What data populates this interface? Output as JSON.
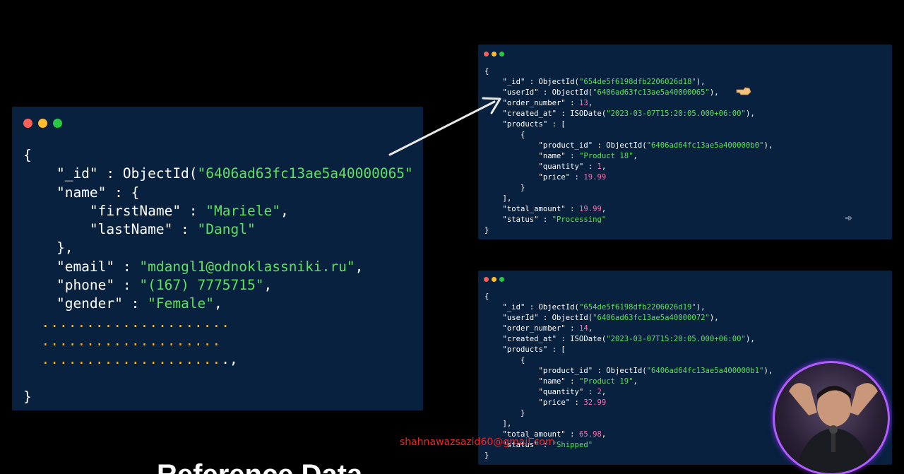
{
  "main_document": {
    "lines": [
      [
        {
          "t": "{",
          "c": "p"
        }
      ],
      [
        {
          "t": "    \"_id\" : ObjectId(",
          "c": "p"
        },
        {
          "t": "\"6406ad63fc13ae5a40000065\"",
          "c": "s"
        }
      ],
      [
        {
          "t": "    \"name\" : {",
          "c": "p"
        }
      ],
      [
        {
          "t": "        \"firstName\" : ",
          "c": "p"
        },
        {
          "t": "\"Mariele\"",
          "c": "s"
        },
        {
          "t": ",",
          "c": "p"
        }
      ],
      [
        {
          "t": "        \"lastName\" : ",
          "c": "p"
        },
        {
          "t": "\"Dangl\"",
          "c": "s"
        }
      ],
      [
        {
          "t": "    },",
          "c": "p"
        }
      ],
      [
        {
          "t": "    \"email\" : ",
          "c": "p"
        },
        {
          "t": "\"mdangl1@odnoklassniki.ru\"",
          "c": "s"
        },
        {
          "t": ",",
          "c": "p"
        }
      ],
      [
        {
          "t": "    \"phone\" : ",
          "c": "p"
        },
        {
          "t": "\"(167) 7775715\"",
          "c": "s"
        },
        {
          "t": ",",
          "c": "p"
        }
      ],
      [
        {
          "t": "    \"gender\" : ",
          "c": "p"
        },
        {
          "t": "\"Female\"",
          "c": "s"
        },
        {
          "t": ",",
          "c": "p"
        }
      ],
      [
        {
          "t": "  .....................",
          "c": "e"
        }
      ],
      [
        {
          "t": "  ....................",
          "c": "e"
        }
      ],
      [
        {
          "t": "  ....................",
          "c": "e"
        },
        {
          "t": ".,",
          "c": "p"
        }
      ],
      [
        {
          "t": "",
          "c": "p"
        }
      ],
      [
        {
          "t": "}",
          "c": "p"
        }
      ]
    ]
  },
  "order_document_1": {
    "lines": [
      [
        {
          "t": "{",
          "c": "p"
        }
      ],
      [
        {
          "t": "    \"_id\" : ObjectId(",
          "c": "p"
        },
        {
          "t": "\"654de5f6198dfb2206026d18\"",
          "c": "s"
        },
        {
          "t": "),",
          "c": "p"
        }
      ],
      [
        {
          "t": "    \"userId\" : ObjectId(",
          "c": "p"
        },
        {
          "t": "\"6406ad63fc13ae5a40000065\"",
          "c": "s"
        },
        {
          "t": "),",
          "c": "p"
        }
      ],
      [
        {
          "t": "    \"order_number\" : ",
          "c": "p"
        },
        {
          "t": "13",
          "c": "n"
        },
        {
          "t": ",",
          "c": "p"
        }
      ],
      [
        {
          "t": "    \"created_at\" : ISODate(",
          "c": "p"
        },
        {
          "t": "\"2023-03-07T15:20:05.000+06:00\"",
          "c": "s"
        },
        {
          "t": "),",
          "c": "p"
        }
      ],
      [
        {
          "t": "    \"products\" : [",
          "c": "p"
        }
      ],
      [
        {
          "t": "        {",
          "c": "p"
        }
      ],
      [
        {
          "t": "            \"product_id\" : ObjectId(",
          "c": "p"
        },
        {
          "t": "\"6406ad64fc13ae5a400000b0\"",
          "c": "s"
        },
        {
          "t": "),",
          "c": "p"
        }
      ],
      [
        {
          "t": "            \"name\" : ",
          "c": "p"
        },
        {
          "t": "\"Product 18\"",
          "c": "s"
        },
        {
          "t": ",",
          "c": "p"
        }
      ],
      [
        {
          "t": "            \"quantity\" : ",
          "c": "p"
        },
        {
          "t": "1",
          "c": "n"
        },
        {
          "t": ",",
          "c": "p"
        }
      ],
      [
        {
          "t": "            \"price\" : ",
          "c": "p"
        },
        {
          "t": "19.99",
          "c": "n"
        }
      ],
      [
        {
          "t": "        }",
          "c": "p"
        }
      ],
      [
        {
          "t": "    ],",
          "c": "p"
        }
      ],
      [
        {
          "t": "    \"total_amount\" : ",
          "c": "p"
        },
        {
          "t": "19.99",
          "c": "n"
        },
        {
          "t": ",",
          "c": "p"
        }
      ],
      [
        {
          "t": "    \"status\" : ",
          "c": "p"
        },
        {
          "t": "\"Processing\"",
          "c": "s"
        }
      ],
      [
        {
          "t": "}",
          "c": "p"
        }
      ]
    ]
  },
  "order_document_2": {
    "lines": [
      [
        {
          "t": "{",
          "c": "p"
        }
      ],
      [
        {
          "t": "    \"_id\" : ObjectId(",
          "c": "p"
        },
        {
          "t": "\"654de5f6198dfb2206026d19\"",
          "c": "s"
        },
        {
          "t": "),",
          "c": "p"
        }
      ],
      [
        {
          "t": "    \"userId\" : ObjectId(",
          "c": "p"
        },
        {
          "t": "\"6406ad63fc13ae5a40000072\"",
          "c": "s"
        },
        {
          "t": "),",
          "c": "p"
        }
      ],
      [
        {
          "t": "    \"order_number\" : ",
          "c": "p"
        },
        {
          "t": "14",
          "c": "n"
        },
        {
          "t": ",",
          "c": "p"
        }
      ],
      [
        {
          "t": "    \"created_at\" : ISODate(",
          "c": "p"
        },
        {
          "t": "\"2023-03-07T15:20:05.000+06:00\"",
          "c": "s"
        },
        {
          "t": "),",
          "c": "p"
        }
      ],
      [
        {
          "t": "    \"products\" : [",
          "c": "p"
        }
      ],
      [
        {
          "t": "        {",
          "c": "p"
        }
      ],
      [
        {
          "t": "            \"product_id\" : ObjectId(",
          "c": "p"
        },
        {
          "t": "\"6406ad64fc13ae5a400000b1\"",
          "c": "s"
        },
        {
          "t": "),",
          "c": "p"
        }
      ],
      [
        {
          "t": "            \"name\" : ",
          "c": "p"
        },
        {
          "t": "\"Product 19\"",
          "c": "s"
        },
        {
          "t": ",",
          "c": "p"
        }
      ],
      [
        {
          "t": "            \"quantity\" : ",
          "c": "p"
        },
        {
          "t": "2",
          "c": "n"
        },
        {
          "t": ",",
          "c": "p"
        }
      ],
      [
        {
          "t": "            \"price\" : ",
          "c": "p"
        },
        {
          "t": "32.99",
          "c": "n"
        }
      ],
      [
        {
          "t": "        }",
          "c": "p"
        }
      ],
      [
        {
          "t": "    ],",
          "c": "p"
        }
      ],
      [
        {
          "t": "    \"total_amount\" : ",
          "c": "p"
        },
        {
          "t": "65.98",
          "c": "n"
        },
        {
          "t": ",",
          "c": "p"
        }
      ],
      [
        {
          "t": "    \"status\" : ",
          "c": "p"
        },
        {
          "t": "\"Shipped\"",
          "c": "s"
        }
      ],
      [
        {
          "t": "}",
          "c": "p"
        }
      ]
    ]
  },
  "watermark": "shahnawazsazid60@gmail.com",
  "bottom_title": "Reference Data",
  "icons": {
    "window_controls": [
      "close-dot",
      "minimize-dot",
      "maximize-dot"
    ],
    "arrow": "reference-arrow",
    "pointer": "hand-pointer-icon",
    "cursor": "cursor-arrow-icon"
  },
  "colors": {
    "panel_bg": "#07213f",
    "string": "#5ee05e",
    "number": "#ff6db0",
    "ellipsis": "#f5b82e",
    "watermark": "#ff2020",
    "webcam_ring": "#b05cff"
  }
}
